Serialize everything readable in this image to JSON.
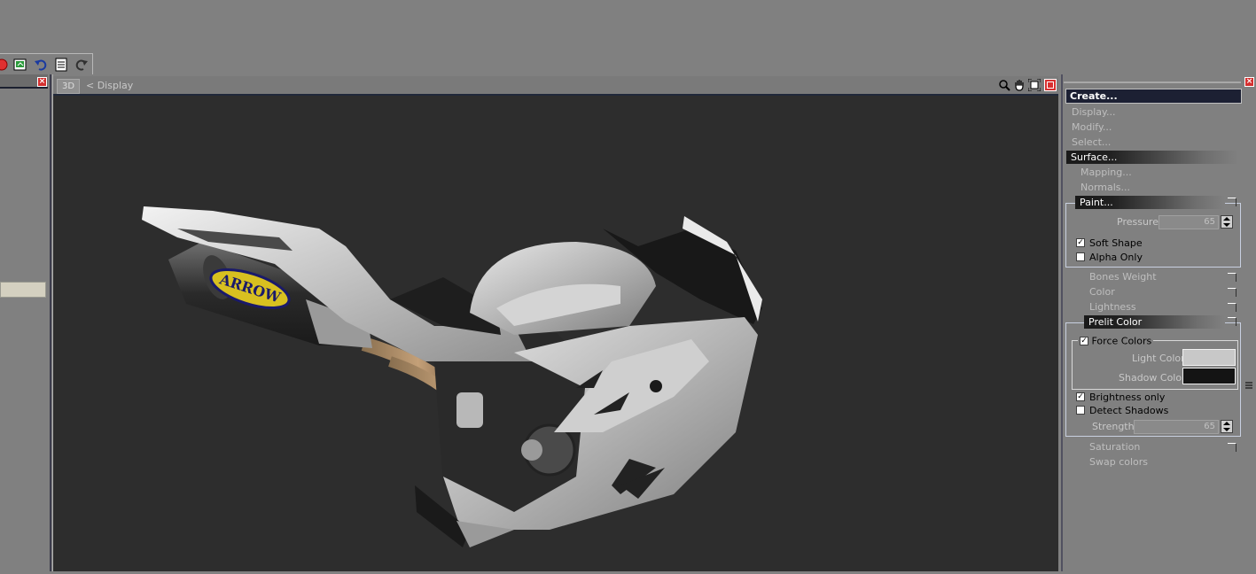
{
  "viewport": {
    "tag": "3D",
    "title": "<  Display"
  },
  "panel": {
    "create": "Create...",
    "items": [
      "Display...",
      "Modify...",
      "Select..."
    ],
    "surface": "Surface...",
    "surface_items": [
      "Mapping...",
      "Normals..."
    ],
    "paint": "Paint...",
    "pressure_label": "Pressure:",
    "pressure_value": "65",
    "soft_shape": "Soft Shape",
    "alpha_only": "Alpha Only",
    "paint_options": [
      "Bones Weight",
      "Color",
      "Lightness"
    ],
    "prelit": "Prelit Color",
    "force_colors": "Force Colors",
    "light_color_label": "Light Color:",
    "shadow_color_label": "Shadow Color:",
    "brightness_only": "Brightness only",
    "detect_shadows": "Detect Shadows",
    "strength_label": "Strength:",
    "strength_value": "65",
    "saturation": "Saturation",
    "swap_colors": "Swap colors"
  },
  "model_decal": "ARROW",
  "colors": {
    "light": "#c8c8c8",
    "shadow": "#141414",
    "viewport_bg": "#2d2d2d"
  }
}
